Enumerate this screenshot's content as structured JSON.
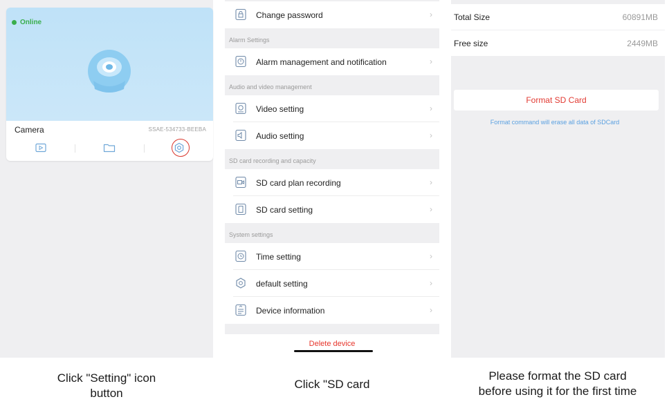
{
  "panel1": {
    "status": "Online",
    "camera_name": "Camera",
    "camera_id": "SSAE-534733-BEEBA",
    "caption_line1": "Click \"Setting\" icon",
    "caption_line2": "button"
  },
  "panel2": {
    "rows": [
      {
        "label": "Change password",
        "icon": "lock-icon"
      },
      {
        "label": "Alarm management and notification",
        "icon": "alarm-icon"
      },
      {
        "label": "Video setting",
        "icon": "camera-icon"
      },
      {
        "label": "Audio setting",
        "icon": "speaker-icon"
      },
      {
        "label": "SD card plan recording",
        "icon": "video-record-icon"
      },
      {
        "label": "SD card setting",
        "icon": "sd-card-icon"
      },
      {
        "label": "Time setting",
        "icon": "clock-icon"
      },
      {
        "label": "default setting",
        "icon": "gear-icon"
      },
      {
        "label": "Device information",
        "icon": "info-icon"
      }
    ],
    "sections": {
      "alarm": "Alarm Settings",
      "audio_video": "Audio and video management",
      "sd": "SD card recording and capacity",
      "system": "System settings"
    },
    "chevron": "›",
    "delete_label": "Delete device",
    "caption": "Click \"SD card"
  },
  "panel3": {
    "total_size_label": "Total Size",
    "total_size_value": "60891MB",
    "free_size_label": "Free size",
    "free_size_value": "2449MB",
    "format_button": "Format SD Card",
    "format_note": "Format command will erase all data of SDCard",
    "caption_line1": "Please format the SD card",
    "caption_line2": "before using it for the first time"
  },
  "colors": {
    "online_green": "#3aae4c",
    "danger_red": "#e23a32",
    "link_blue": "#5aa0e0",
    "highlight_ring": "#d9362c"
  }
}
